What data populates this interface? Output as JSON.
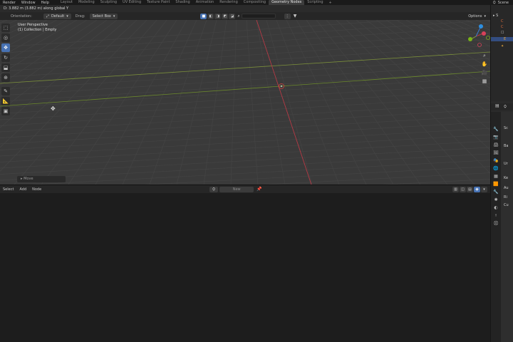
{
  "topbar": {
    "menus": [
      "Render",
      "Window",
      "Help"
    ],
    "workspaces": [
      "Layout",
      "Modeling",
      "Sculpting",
      "UV Editing",
      "Texture Paint",
      "Shading",
      "Animation",
      "Rendering",
      "Compositing",
      "Geometry Nodes",
      "Scripting"
    ],
    "active_workspace": "Geometry Nodes",
    "add_tab": "+",
    "scene_label": "Scene"
  },
  "status": {
    "text": "D: 3.882 m (3.882 m) along global Y"
  },
  "viewport_header": {
    "orientation_label": "Orientation:",
    "orientation_value": "Default",
    "drag_label": "Drag:",
    "drag_value": "Select Box",
    "options_label": "Options"
  },
  "viewport": {
    "perspective": "User Perspective",
    "collection": "(1) Collection | Empty",
    "last_op": "Move",
    "colors": {
      "grid_bg": "#3a3a3a",
      "x_axis": "#b53a46",
      "y_axis": "#8aa832",
      "selection": "#4772b3"
    }
  },
  "node_editor": {
    "menus": [
      "Select",
      "Add",
      "Node"
    ],
    "new_label": "New"
  },
  "outliner": {
    "rows": [
      "S",
      "C",
      "C",
      "E"
    ]
  },
  "properties": {
    "rows": [
      "Sc",
      "Ba",
      "Ur",
      "Ke",
      "Au",
      "Ri",
      "Cu"
    ]
  }
}
